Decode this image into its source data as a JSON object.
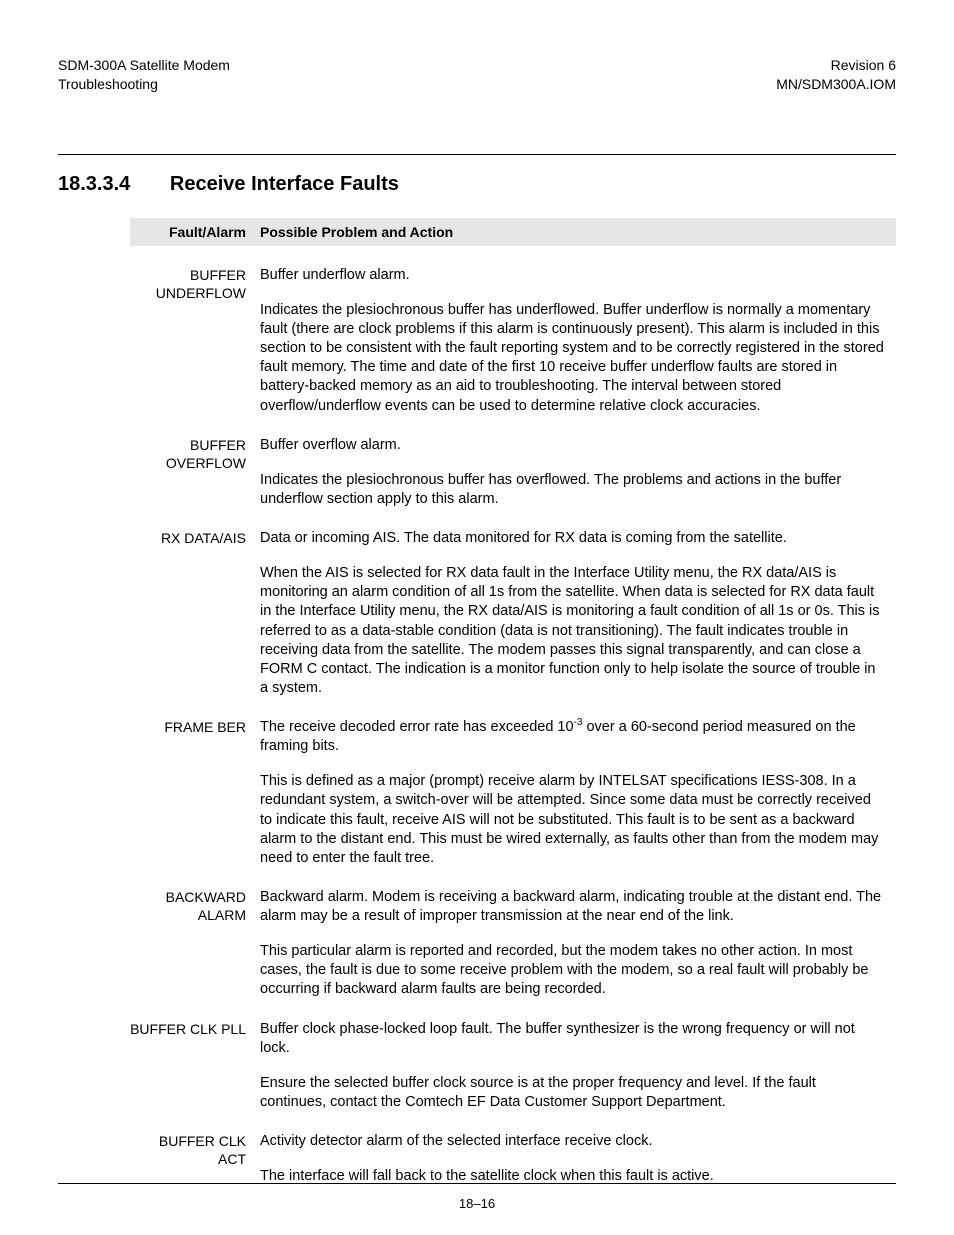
{
  "header": {
    "left_line1": "SDM-300A Satellite Modem",
    "left_line2": "Troubleshooting",
    "right_line1": "Revision 6",
    "right_line2": "MN/SDM300A.IOM"
  },
  "section": {
    "number": "18.3.3.4",
    "title": "Receive Interface Faults"
  },
  "table_head": {
    "col1": "Fault/Alarm",
    "col2": "Possible Problem and Action"
  },
  "rows": [
    {
      "name": "BUFFER UNDERFLOW",
      "paras": [
        "Buffer underflow alarm.",
        "Indicates the plesiochronous buffer has underflowed. Buffer underflow is normally a momentary fault (there are clock problems if this alarm is continuously present). This alarm is included in this section to be consistent with the fault reporting system and to be correctly registered in the stored fault memory. The time and date of the first 10 receive buffer underflow faults are stored in battery-backed memory as an aid to troubleshooting. The interval between stored overflow/underflow events can be used to determine relative clock accuracies."
      ]
    },
    {
      "name": "BUFFER OVERFLOW",
      "paras": [
        "Buffer overflow alarm.",
        "Indicates the plesiochronous buffer has overflowed. The problems and actions in the buffer underflow section apply to this alarm."
      ]
    },
    {
      "name": "RX DATA/AIS",
      "paras": [
        "Data or incoming AIS. The data monitored for RX data is coming from the satellite.",
        "When the AIS is selected for RX data fault in the Interface Utility menu, the RX data/AIS is monitoring an alarm condition of all 1s from the satellite. When data is selected for RX data fault in the Interface Utility menu, the RX data/AIS is monitoring a fault condition of all 1s or 0s. This is referred to as a data-stable condition (data is not transitioning). The fault indicates trouble in receiving data from the satellite. The modem passes this signal transparently, and can close a FORM C contact. The indication is a monitor function only to help isolate the source of trouble in a system."
      ]
    },
    {
      "name": "FRAME BER",
      "paras_html": [
        "The receive decoded error rate has exceeded 10<sup>-3</sup> over a 60-second period measured on the framing bits.",
        "This is defined as a major (prompt) receive alarm by INTELSAT specifications IESS-308. In a redundant system, a switch-over will be attempted. Since some data must be correctly received to indicate this fault, receive AIS will not be substituted. This fault is to be sent as a backward alarm to the distant end. This must be wired externally, as faults other than from the modem may need to enter the fault tree."
      ]
    },
    {
      "name": "BACKWARD ALARM",
      "paras": [
        "Backward alarm. Modem is receiving a backward alarm, indicating trouble at the distant end. The alarm may be a result of improper transmission at the near end of the link.",
        "This particular alarm is reported and recorded, but the modem takes no other action. In most cases, the fault is due to some receive problem with the modem, so a real fault will probably be occurring if backward alarm faults are being recorded."
      ]
    },
    {
      "name": "BUFFER CLK PLL",
      "paras": [
        "Buffer clock phase-locked loop fault. The buffer synthesizer is the wrong frequency or will not lock.",
        "Ensure the selected buffer clock source is at the proper frequency and level. If the fault continues, contact the Comtech EF Data Customer Support Department."
      ]
    },
    {
      "name": "BUFFER CLK ACT",
      "paras": [
        "Activity detector alarm of the selected interface receive clock.",
        "The interface will fall back to the satellite clock when this fault is active."
      ]
    }
  ],
  "page_number": "18–16"
}
